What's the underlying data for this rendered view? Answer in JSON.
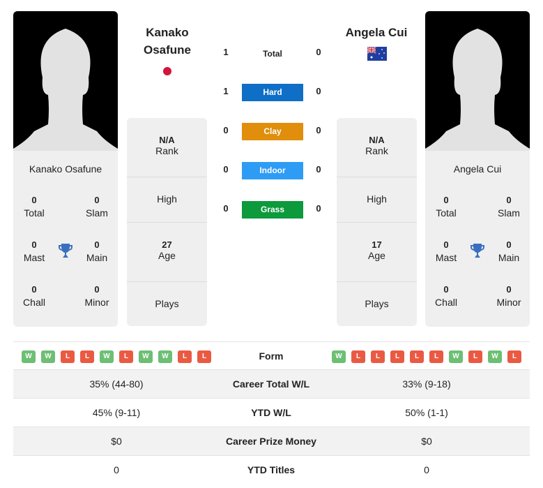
{
  "player1": {
    "name": "Kanako Osafune",
    "header_name_line1": "Kanako",
    "header_name_line2": "Osafune",
    "flag": "japan-flag",
    "titles": {
      "total": "0",
      "slam": "0",
      "mast": "0",
      "main": "0",
      "chall": "0",
      "minor": "0"
    },
    "rank": "N/A",
    "high": "",
    "age": "27",
    "plays": "",
    "form": [
      "W",
      "W",
      "L",
      "L",
      "W",
      "L",
      "W",
      "W",
      "L",
      "L"
    ],
    "career_total_wl": "35% (44-80)",
    "ytd_wl": "45% (9-11)",
    "career_prize_money": "$0",
    "ytd_titles": "0"
  },
  "player2": {
    "name": "Angela Cui",
    "header_name": "Angela Cui",
    "flag": "australia-flag",
    "titles": {
      "total": "0",
      "slam": "0",
      "mast": "0",
      "main": "0",
      "chall": "0",
      "minor": "0"
    },
    "rank": "N/A",
    "high": "",
    "age": "17",
    "plays": "",
    "form": [
      "W",
      "L",
      "L",
      "L",
      "L",
      "L",
      "W",
      "L",
      "W",
      "L"
    ],
    "career_total_wl": "33% (9-18)",
    "ytd_wl": "50% (1-1)",
    "career_prize_money": "$0",
    "ytd_titles": "0"
  },
  "labels": {
    "total": "Total",
    "slam": "Slam",
    "mast": "Mast",
    "main": "Main",
    "chall": "Chall",
    "minor": "Minor",
    "rank": "Rank",
    "high": "High",
    "age": "Age",
    "plays": "Plays",
    "form": "Form",
    "career_total_wl": "Career Total W/L",
    "ytd_wl": "YTD W/L",
    "career_prize_money": "Career Prize Money",
    "ytd_titles": "YTD Titles"
  },
  "h2h": {
    "total": {
      "label": "Total",
      "p1": "1",
      "p2": "0"
    },
    "surfaces": [
      {
        "label": "Hard",
        "p1": "1",
        "p2": "0",
        "color": "#0f6fc6"
      },
      {
        "label": "Clay",
        "p1": "0",
        "p2": "0",
        "color": "#e08e0b"
      },
      {
        "label": "Indoor",
        "p1": "0",
        "p2": "0",
        "color": "#2e9cf5"
      },
      {
        "label": "Grass",
        "p1": "0",
        "p2": "0",
        "color": "#0c9a3c"
      }
    ]
  },
  "colors": {
    "win": "#6cbf73",
    "loss": "#ea5a43",
    "trophy": "#3a6fc0"
  }
}
